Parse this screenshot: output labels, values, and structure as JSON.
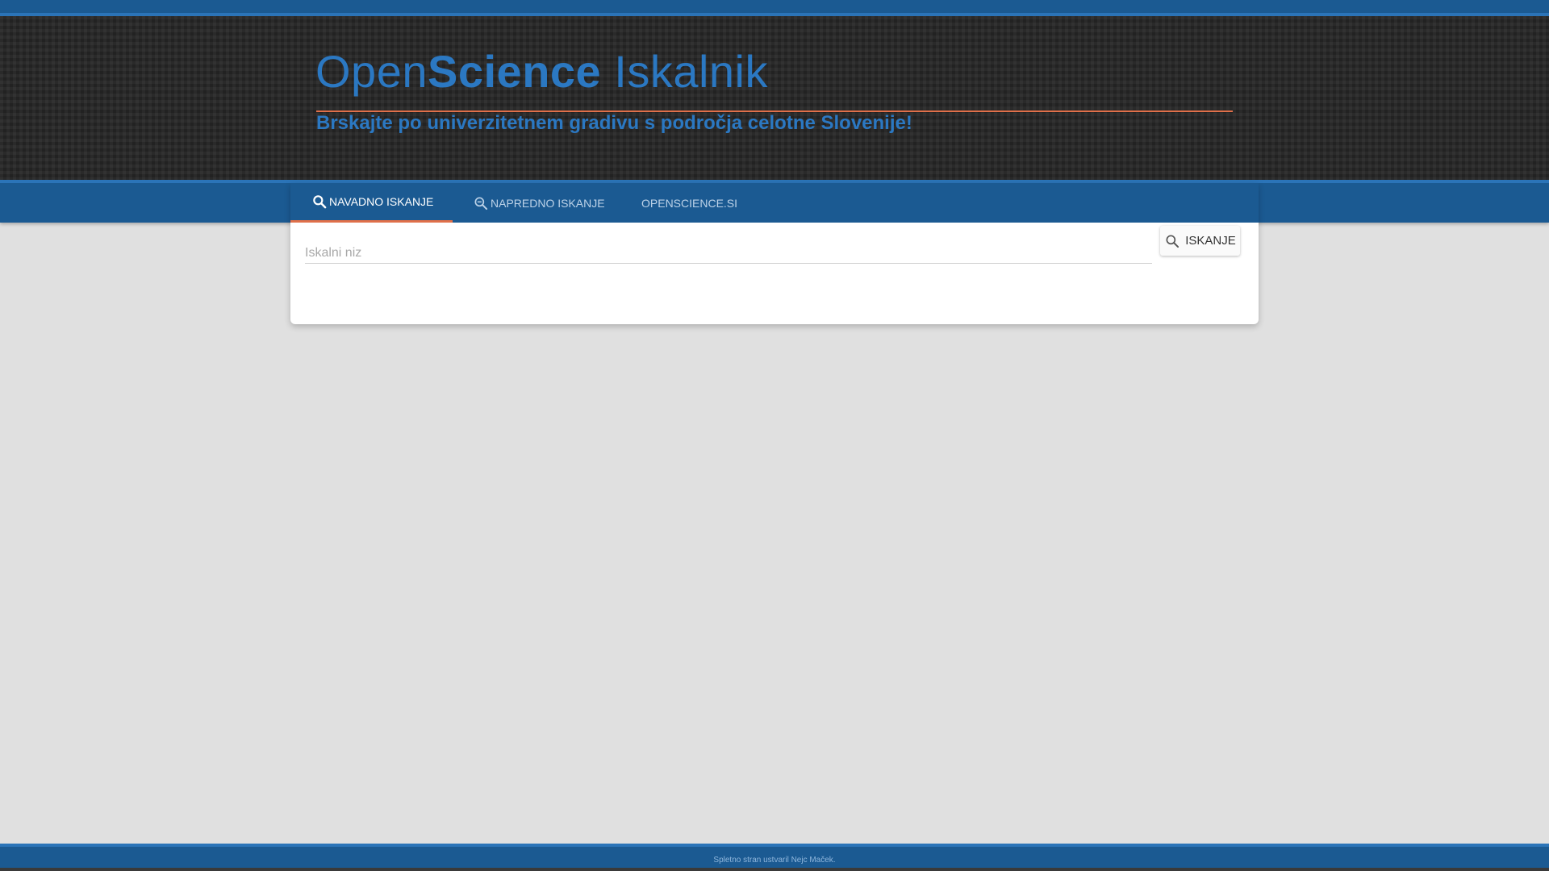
{
  "header": {
    "title_prefix": "Open",
    "title_bold": "Science",
    "title_suffix": " Iskalnik",
    "subtitle": "Brskajte po univerzitetnem gradivu s področja celotne Slovenije!"
  },
  "tabs": [
    {
      "label": "NAVADNO ISKANJE",
      "icon": "search-icon",
      "active": true
    },
    {
      "label": "NAPREDNO ISKANJE",
      "icon": "search-advanced-icon",
      "active": false
    },
    {
      "label": "OPENSCIENCE.SI",
      "active": false
    }
  ],
  "search": {
    "placeholder": "Iskalni niz",
    "value": "",
    "button_label": "ISKANJE",
    "button_icon": "search-icon"
  },
  "footer": {
    "text": "Spletno stran ustvaril Nejc Maček."
  },
  "colors": {
    "primary": "#1b5a92",
    "title_blue": "#2b78c2",
    "accent": "#e0704a",
    "background": "#e0e0e0"
  }
}
